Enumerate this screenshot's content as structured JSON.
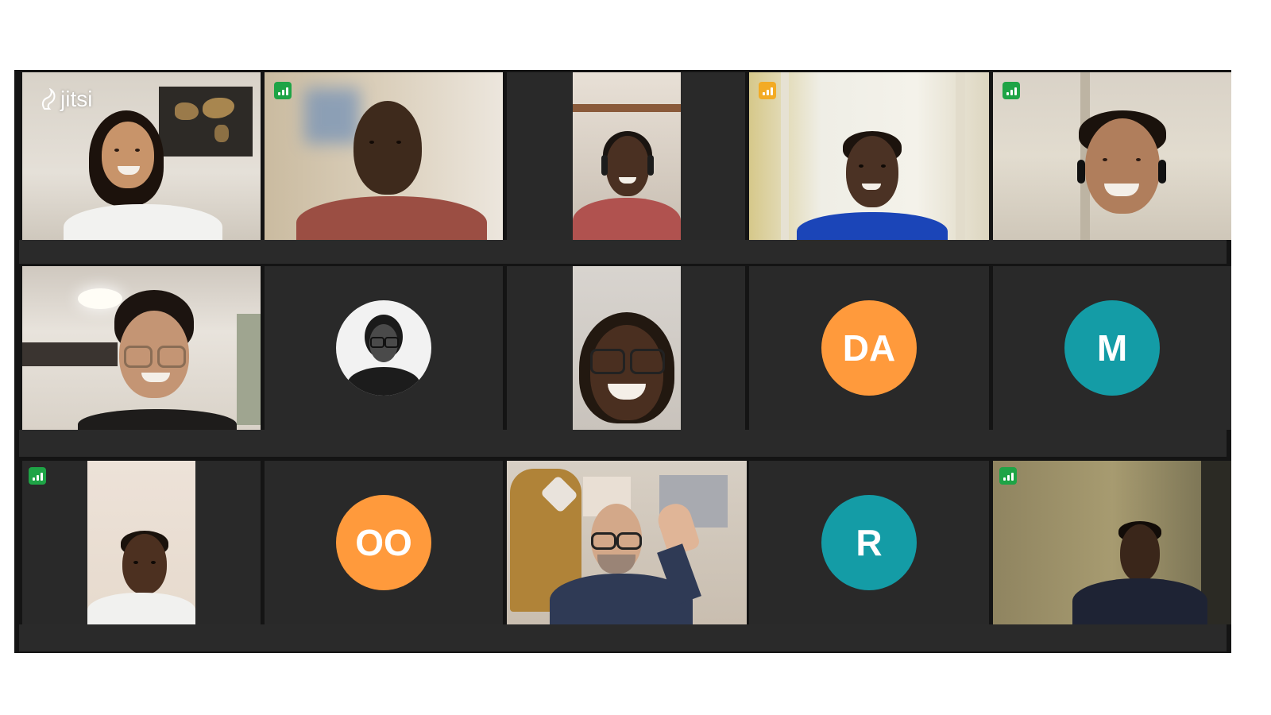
{
  "app": {
    "logo_text": "jitsi"
  },
  "colors": {
    "avatar_orange": "#ff9a3c",
    "avatar_teal": "#149ca6",
    "connection_good": "#1ea446",
    "connection_fair": "#f3ab24",
    "active_outline": "#2d6fd6",
    "tile_background": "#292929"
  },
  "participants": [
    {
      "type": "video",
      "connection": "none",
      "active": true
    },
    {
      "type": "video",
      "connection": "good"
    },
    {
      "type": "video",
      "connection": "none"
    },
    {
      "type": "video",
      "connection": "fair"
    },
    {
      "type": "video",
      "connection": "good"
    },
    {
      "type": "video",
      "connection": "none"
    },
    {
      "type": "photo-avatar",
      "connection": "none"
    },
    {
      "type": "video",
      "connection": "none"
    },
    {
      "type": "initials",
      "initials": "DA",
      "color": "#ff9a3c"
    },
    {
      "type": "initials",
      "initials": "M",
      "color": "#149ca6"
    },
    {
      "type": "video",
      "connection": "good"
    },
    {
      "type": "initials",
      "initials": "OO",
      "color": "#ff9a3c"
    },
    {
      "type": "video",
      "connection": "none"
    },
    {
      "type": "initials",
      "initials": "R",
      "color": "#149ca6"
    },
    {
      "type": "video",
      "connection": "good"
    }
  ],
  "icons": {
    "connection": "signal-bars-icon",
    "logo": "jitsi-logo-icon"
  }
}
